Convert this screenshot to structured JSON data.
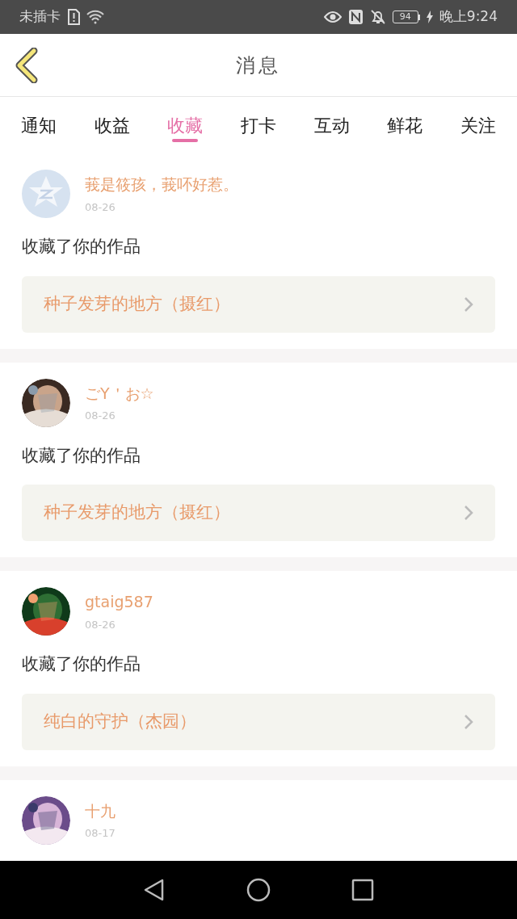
{
  "status_bar": {
    "carrier": "未插卡",
    "battery": "94",
    "time": "晚上9:24"
  },
  "header": {
    "title": "消息"
  },
  "tabs": [
    {
      "label": "通知",
      "selected": false
    },
    {
      "label": "收益",
      "selected": false
    },
    {
      "label": "收藏",
      "selected": true
    },
    {
      "label": "打卡",
      "selected": false
    },
    {
      "label": "互动",
      "selected": false
    },
    {
      "label": "鲜花",
      "selected": false
    },
    {
      "label": "关注",
      "selected": false
    }
  ],
  "messages": [
    {
      "user": "莪是筱孩，莪吥好惹。",
      "date": "08-26",
      "avatar": {
        "kind": "default"
      },
      "text": "收藏了你的作品",
      "work": "种子发芽的地方（摄红）"
    },
    {
      "user": "ごY＇お☆",
      "date": "08-26",
      "text": "收藏了你的作品",
      "work": "种子发芽的地方（摄红）"
    },
    {
      "user": "gtaig587",
      "date": "08-26",
      "text": "收藏了你的作品",
      "work": "纯白的守护（杰园）"
    },
    {
      "user": "十九",
      "date": "08-17"
    }
  ]
}
